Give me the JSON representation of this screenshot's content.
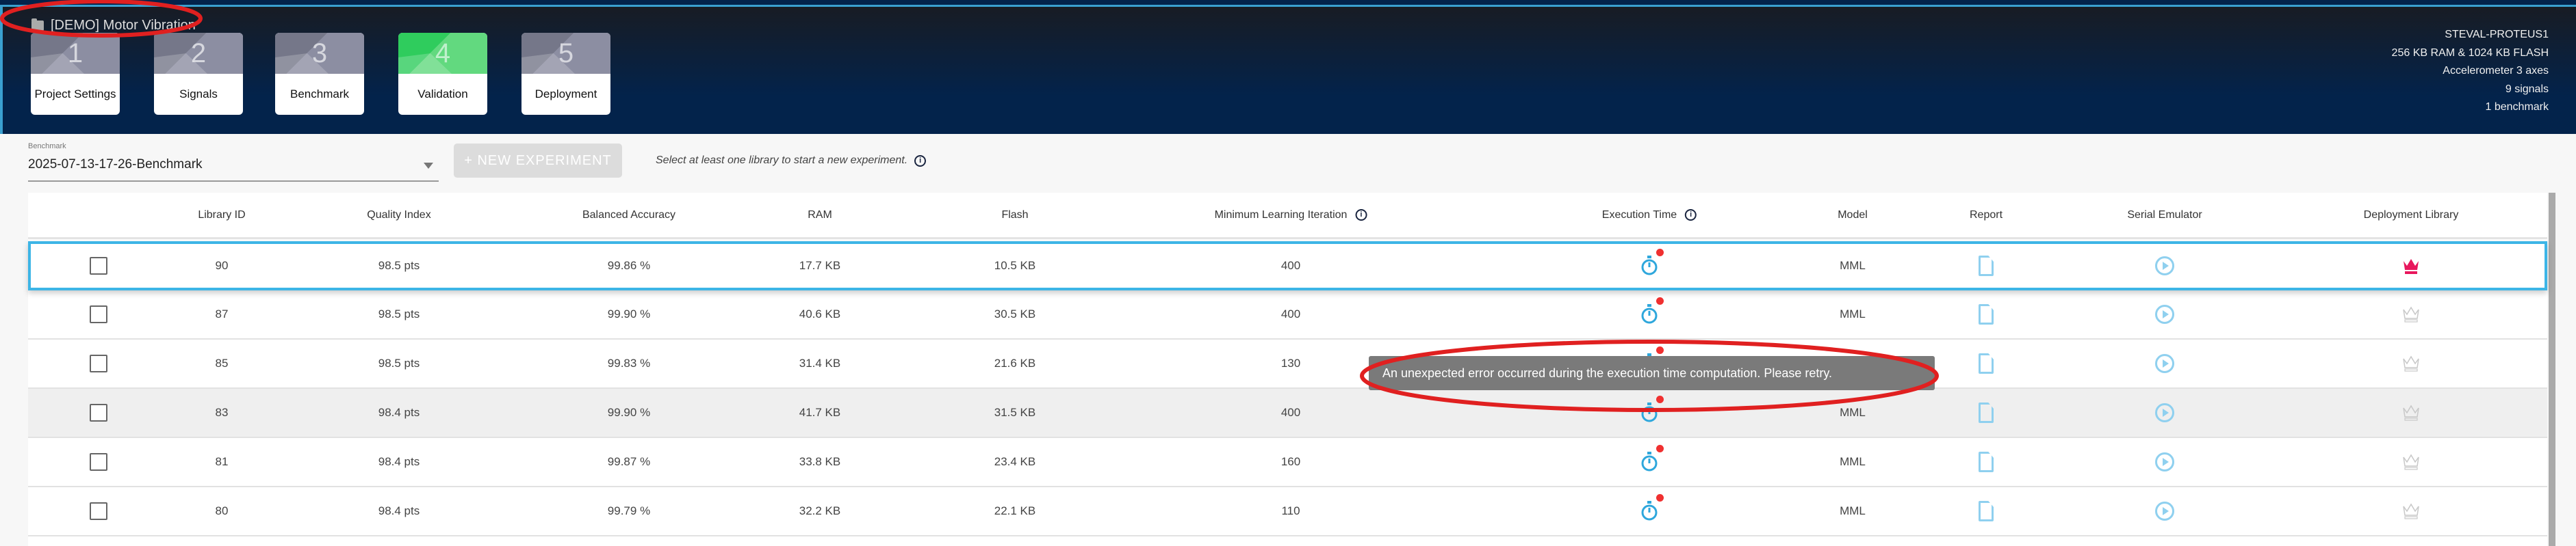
{
  "project": {
    "title": "[DEMO] Motor Vibration",
    "icon": "folder-icon"
  },
  "steps": [
    {
      "num": "1",
      "label": "Project Settings",
      "active": false
    },
    {
      "num": "2",
      "label": "Signals",
      "active": false
    },
    {
      "num": "3",
      "label": "Benchmark",
      "active": false
    },
    {
      "num": "4",
      "label": "Validation",
      "active": true
    },
    {
      "num": "5",
      "label": "Deployment",
      "active": false
    }
  ],
  "device": {
    "name": "STEVAL-PROTEUS1",
    "memory": "256 KB RAM & 1024 KB FLASH",
    "sensor": "Accelerometer 3 axes",
    "signals": "9 signals",
    "benchmarks": "1 benchmark"
  },
  "benchmark": {
    "label": "Benchmark",
    "value": "2025-07-13-17-26-Benchmark"
  },
  "new_experiment": {
    "label": "+  NEW EXPERIMENT"
  },
  "hint": "Select at least one library to start a new experiment.",
  "table": {
    "headers": [
      "Library ID",
      "Quality Index",
      "Balanced Accuracy",
      "RAM",
      "Flash",
      "Minimum Learning Iteration",
      "Execution Time",
      "Model",
      "Report",
      "Serial Emulator",
      "Deployment Library"
    ],
    "rows": [
      {
        "id": "90",
        "quality": "98.5 pts",
        "accuracy": "99.86 %",
        "ram": "17.7 KB",
        "flash": "10.5 KB",
        "iter": "400",
        "model": "MML",
        "selected": true
      },
      {
        "id": "87",
        "quality": "98.5 pts",
        "accuracy": "99.90 %",
        "ram": "40.6 KB",
        "flash": "30.5 KB",
        "iter": "400",
        "model": "MML"
      },
      {
        "id": "85",
        "quality": "98.5 pts",
        "accuracy": "99.83 %",
        "ram": "31.4 KB",
        "flash": "21.6 KB",
        "iter": "130",
        "model": "MML"
      },
      {
        "id": "83",
        "quality": "98.4 pts",
        "accuracy": "99.90 %",
        "ram": "41.7 KB",
        "flash": "31.5 KB",
        "iter": "400",
        "model": "MML"
      },
      {
        "id": "81",
        "quality": "98.4 pts",
        "accuracy": "99.87 %",
        "ram": "33.8 KB",
        "flash": "23.4 KB",
        "iter": "160",
        "model": "MML"
      },
      {
        "id": "80",
        "quality": "98.4 pts",
        "accuracy": "99.79 %",
        "ram": "32.2 KB",
        "flash": "22.1 KB",
        "iter": "110",
        "model": "MML"
      }
    ]
  },
  "tooltip": "An unexpected error occurred during the execution time computation. Please retry.",
  "colors": {
    "accent": "#3db5e6",
    "active_step": "#2fcc5d",
    "crown_active": "#e8175d",
    "error_dot": "#f03030",
    "annotation": "#e02020"
  }
}
